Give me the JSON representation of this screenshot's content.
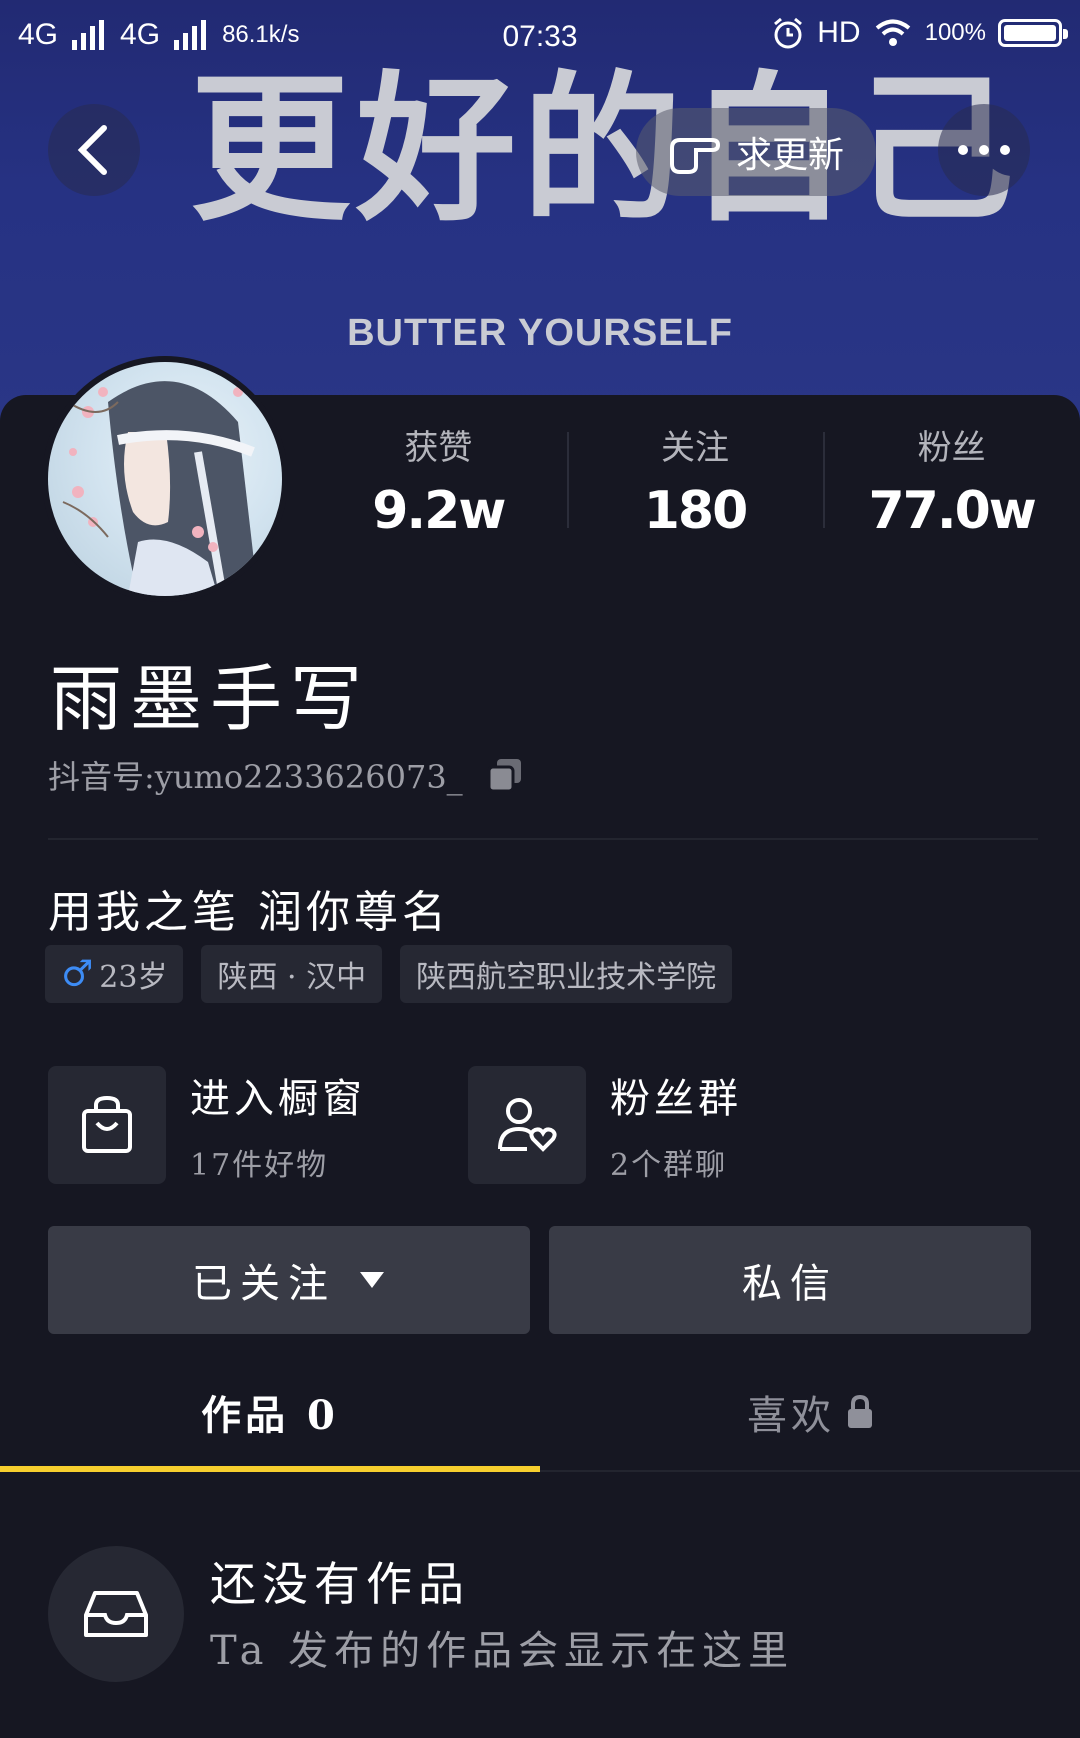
{
  "status_bar": {
    "network_1": "4G",
    "network_2": "4G",
    "speed": "86.1k/s",
    "time": "07:33",
    "hd": "HD",
    "battery": "100%",
    "battery_level": 1.0
  },
  "banner": {
    "big_text": "更好的自己",
    "sub_text": "BUTTER YOURSELF"
  },
  "nav": {
    "back_icon": "chevron-left-icon",
    "update_label": "求更新",
    "more_icon": "more-icon"
  },
  "stats": [
    {
      "label": "获赞",
      "value": "9.2w"
    },
    {
      "label": "关注",
      "value": "180"
    },
    {
      "label": "粉丝",
      "value": "77.0w"
    }
  ],
  "profile": {
    "name": "雨墨手写",
    "douyin_id": "抖音号:yumo2233626073_",
    "bio": "用我之笔  润你尊名",
    "tags": {
      "gender_symbol": "♂",
      "age": "23岁",
      "location": "陕西 · 汉中",
      "school": "陕西航空职业技术学院"
    }
  },
  "cards": {
    "shop": {
      "title": "进入橱窗",
      "sub": "17件好物"
    },
    "fans": {
      "title": "粉丝群",
      "sub": "2个群聊"
    }
  },
  "actions": {
    "follow_label": "已关注",
    "message_label": "私信"
  },
  "tabs": {
    "works_label": "作品 0",
    "likes_label": "喜欢"
  },
  "empty_state": {
    "title": "还没有作品",
    "subtitle": "Ta 发布的作品会显示在这里"
  },
  "colors": {
    "accent": "#f7cf2e",
    "male": "#3d8cf5",
    "background": "#161722",
    "banner": "#263283"
  }
}
